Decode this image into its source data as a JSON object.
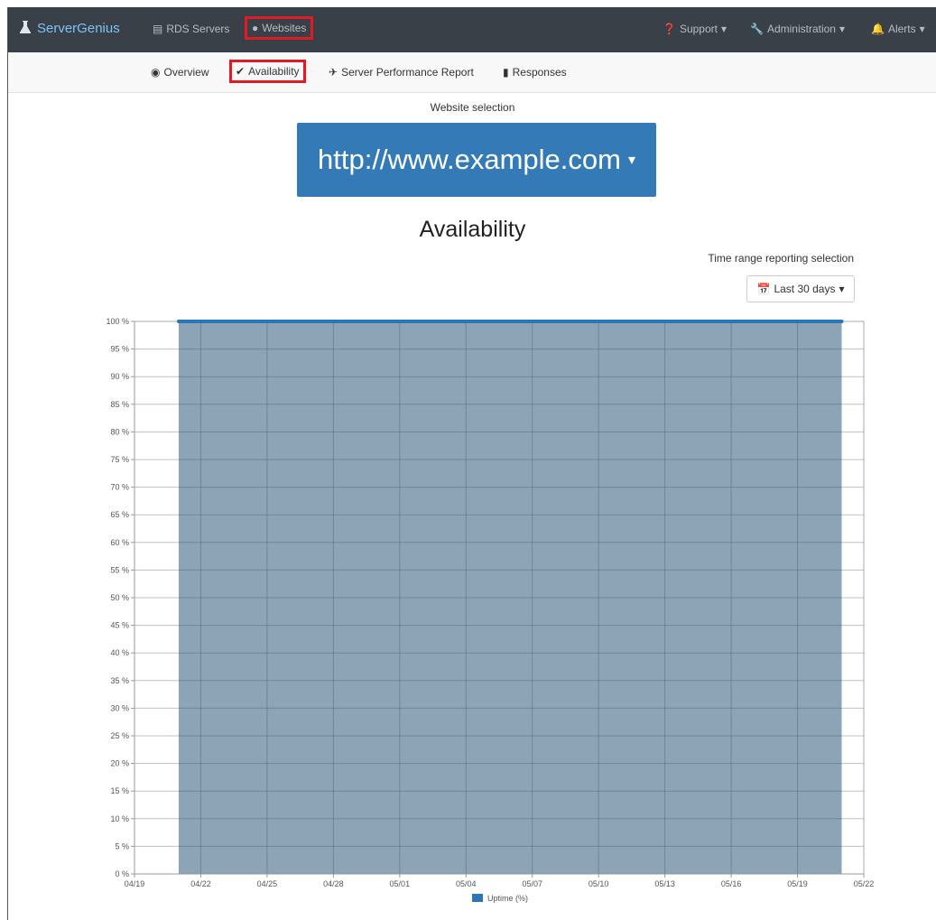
{
  "navbar": {
    "brand": "ServerGenius",
    "items": [
      {
        "label": "RDS Servers"
      },
      {
        "label": "Websites"
      },
      {
        "label": "Support"
      },
      {
        "label": "Administration"
      },
      {
        "label": "Alerts"
      }
    ]
  },
  "subnav": {
    "items": [
      {
        "label": "Overview"
      },
      {
        "label": "Availability"
      },
      {
        "label": "Server Performance Report"
      },
      {
        "label": "Responses"
      }
    ]
  },
  "website_selection": {
    "label": "Website selection",
    "selected": "http://www.example.com"
  },
  "page_title": "Availability",
  "time_range": {
    "label": "Time range reporting selection",
    "selected": "Last 30 days"
  },
  "colors": {
    "accent": "#337ab7",
    "navbar": "#3a4048",
    "area_fill": "#8ca4b6",
    "line": "#2a76b8",
    "highlight": "#e01b24"
  },
  "chart_data": {
    "type": "area",
    "x_ticks": [
      "04/19",
      "04/22",
      "04/25",
      "04/28",
      "05/01",
      "05/04",
      "05/07",
      "05/10",
      "05/13",
      "05/16",
      "05/19",
      "05/22"
    ],
    "y_ticks": [
      "0 %",
      "5 %",
      "10 %",
      "15 %",
      "20 %",
      "25 %",
      "30 %",
      "35 %",
      "40 %",
      "45 %",
      "50 %",
      "55 %",
      "60 %",
      "65 %",
      "70 %",
      "75 %",
      "80 %",
      "85 %",
      "90 %",
      "95 %",
      "100 %"
    ],
    "ylim": [
      0,
      100
    ],
    "series": [
      {
        "name": "Uptime (%)",
        "x_start": "04/21",
        "x_end": "05/21",
        "value": 100
      }
    ],
    "legend": "bottom-center",
    "grid": true
  }
}
